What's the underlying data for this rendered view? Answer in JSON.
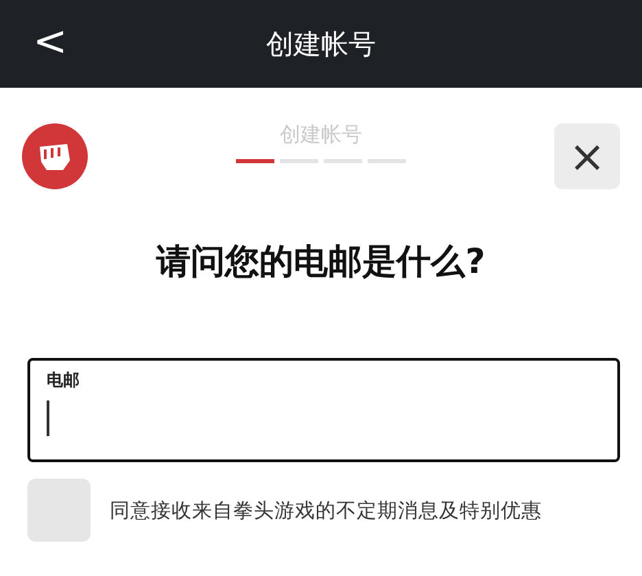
{
  "header": {
    "back_icon": "<",
    "title": "创建帐号"
  },
  "progress": {
    "label": "创建帐号",
    "steps": [
      {
        "selected": true
      },
      {
        "selected": false
      },
      {
        "selected": false
      },
      {
        "selected": false
      }
    ]
  },
  "close": {
    "label": "×"
  },
  "question": "请问您的电邮是什么?",
  "email_field": {
    "label": "电邮"
  },
  "consent": {
    "checked": false,
    "label": "同意接收来自拳头游戏的不定期消息及特别优惠"
  }
}
